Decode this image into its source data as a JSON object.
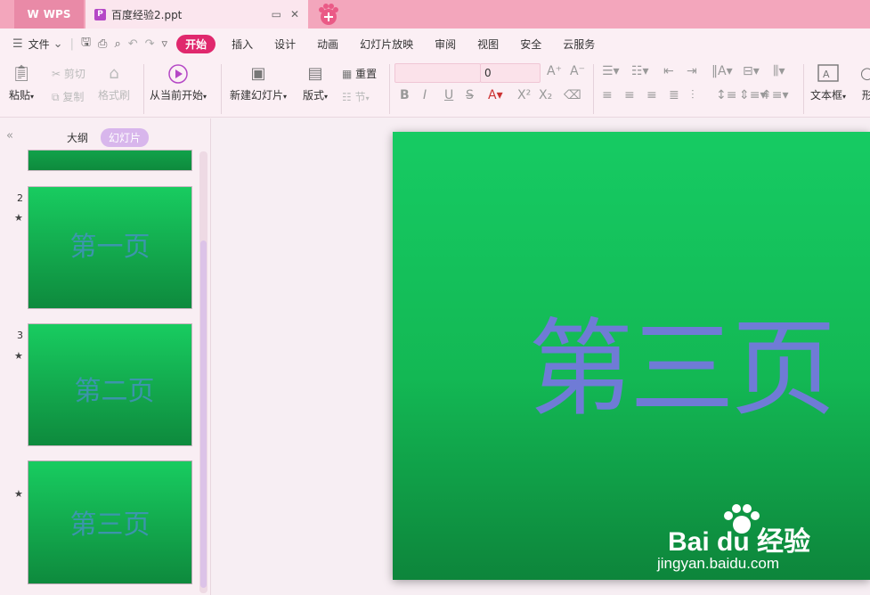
{
  "app": {
    "name": "WPS",
    "doc_title": "百度经验2.ppt"
  },
  "menu": {
    "file_label": "文件",
    "tabs": [
      "开始",
      "插入",
      "设计",
      "动画",
      "幻灯片放映",
      "审阅",
      "视图",
      "安全",
      "云服务"
    ],
    "active_tab": "开始"
  },
  "ribbon": {
    "paste": "粘贴",
    "cut": "剪切",
    "copy": "复制",
    "format_painter": "格式刷",
    "play_from_current": "从当前开始",
    "new_slide": "新建幻灯片",
    "layout": "版式",
    "reset": "重置",
    "section": "节",
    "font_size": "0",
    "text_box": "文本框",
    "shape_partial": "形"
  },
  "panel": {
    "tab_outline": "大纲",
    "tab_slides": "幻灯片",
    "slides": [
      {
        "num": "2",
        "text": "第一页"
      },
      {
        "num": "3",
        "text": "第二页"
      },
      {
        "num": "",
        "text": "第三页"
      }
    ]
  },
  "main_slide": {
    "title": "第三页"
  },
  "watermark": {
    "logo": "Bai du 经验",
    "url": "jingyan.baidu.com"
  },
  "colors": {
    "accent": "#e0286d",
    "titlebar": "#f3a6bc",
    "slide_green": "#13b854",
    "slide_text": "#6f7bd6"
  }
}
